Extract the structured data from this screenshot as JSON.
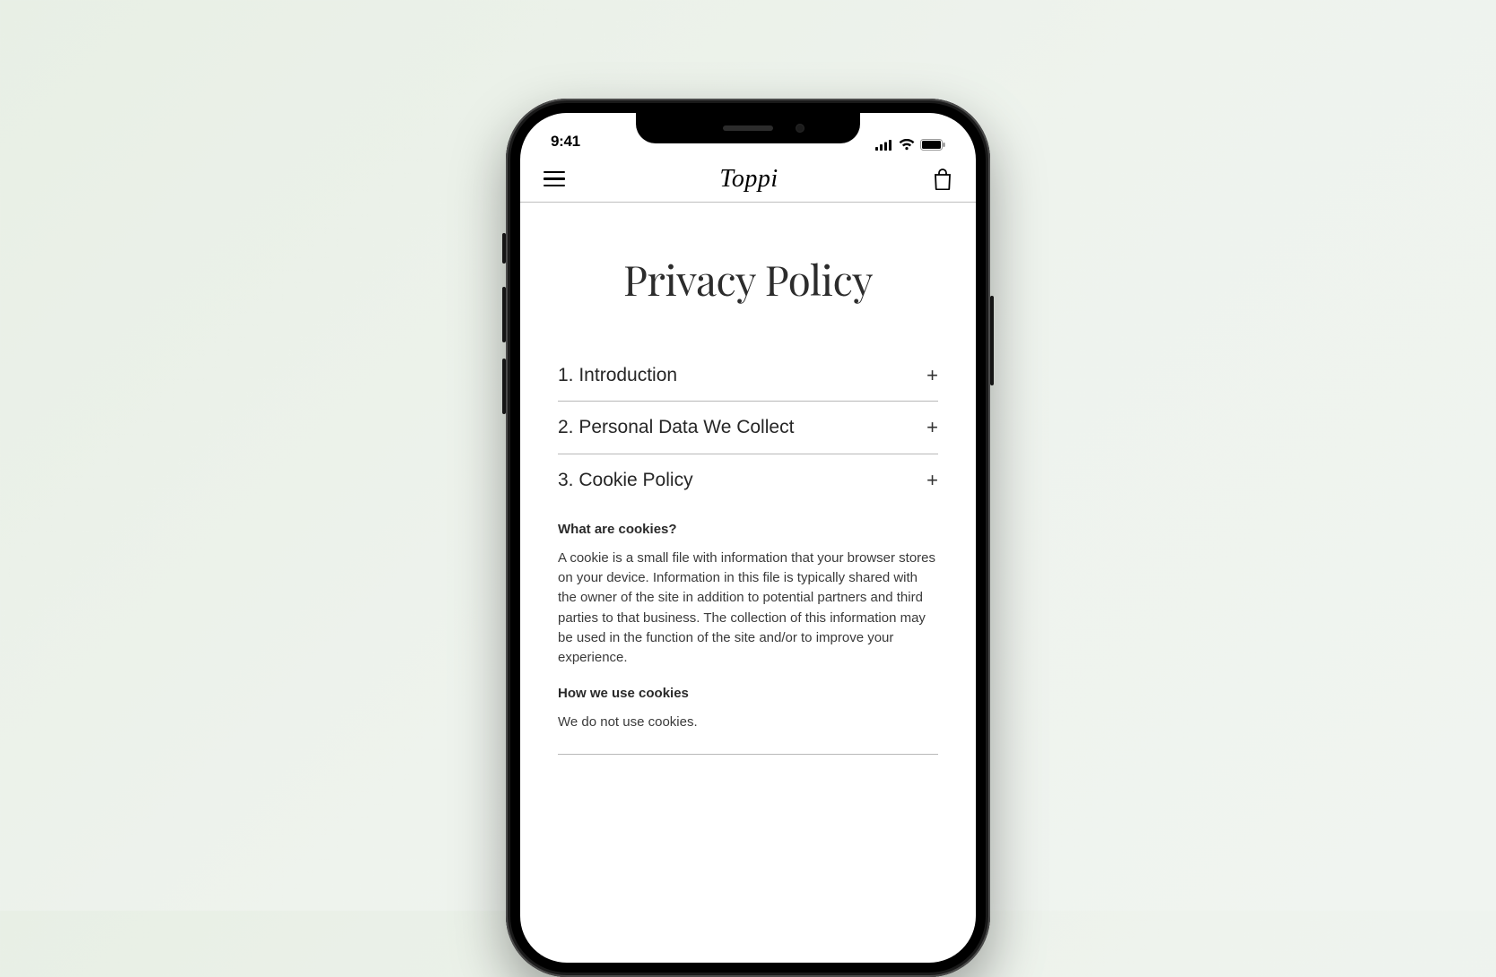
{
  "status": {
    "time": "9:41"
  },
  "header": {
    "logo": "Toppi"
  },
  "page": {
    "title": "Privacy Policy"
  },
  "sections": {
    "s1_label": "1. Introduction",
    "s2_label": "2. Personal Data We Collect",
    "s3_label": "3. Cookie Policy",
    "expand_glyph": "+"
  },
  "cookie": {
    "h1": "What are cookies?",
    "p1": "A cookie is a small file with information that your browser stores on your device. Information in this file is typically shared with the owner of the site in addition to potential partners and third parties to that business. The collection of this information may be used in the function of the site and/or to improve your experience.",
    "h2": "How we use cookies",
    "p2": "We do not use cookies."
  }
}
